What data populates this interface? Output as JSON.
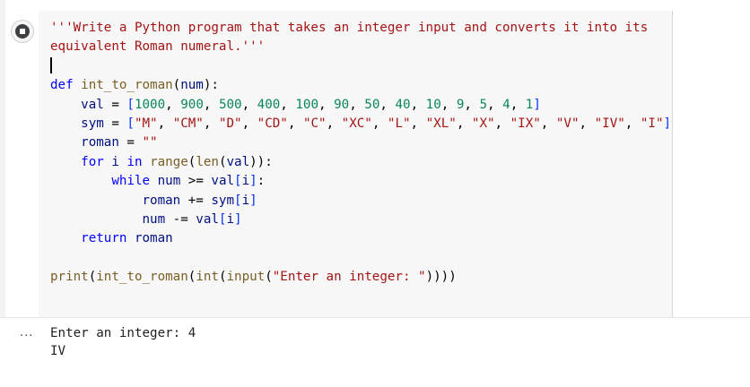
{
  "cell": {
    "run_icon": "run-cell-icon",
    "output_menu_icon": "more-horizontal-icon",
    "output_menu_label": "..."
  },
  "code": {
    "docstring_line1": "'''Write a Python program that takes an integer input and converts it into its",
    "docstring_line2": "equivalent Roman numeral.'''",
    "lines": [
      "def int_to_roman(num):",
      "    val = [1000, 900, 500, 400, 100, 90, 50, 40, 10, 9, 5, 4, 1]",
      "    sym = [\"M\", \"CM\", \"D\", \"CD\", \"C\", \"XC\", \"L\", \"XL\", \"X\", \"IX\", \"V\", \"IV\", \"I\"]",
      "    roman = \"\"",
      "    for i in range(len(val)):",
      "        while num >= val[i]:",
      "            roman += sym[i]",
      "            num -= val[i]",
      "    return roman",
      "print(int_to_roman(int(input(\"Enter an integer: \"))))"
    ]
  },
  "output": {
    "lines": [
      "Enter an integer: 4",
      "IV"
    ]
  },
  "colors": {
    "keyword": "#0000ff",
    "string": "#a31515",
    "number": "#098658",
    "function": "#795e26",
    "variable": "#001080",
    "bracket": "#0431fa",
    "code_background": "#f7f7f7"
  }
}
